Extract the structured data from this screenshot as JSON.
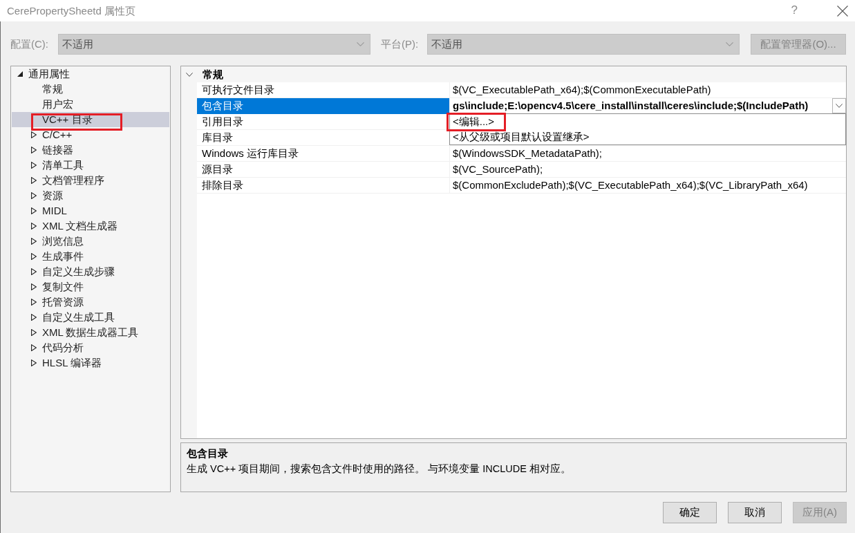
{
  "window": {
    "title": "CerePropertySheetd 属性页",
    "help": "?"
  },
  "config_bar": {
    "configuration": {
      "label": "配置(C):",
      "value": "不适用",
      "disabled": true
    },
    "platform": {
      "label": "平台(P):",
      "value": "不适用",
      "disabled": true
    },
    "manager_button": {
      "label": "配置管理器(O)...",
      "disabled": true
    }
  },
  "tree": {
    "items": [
      {
        "label": "通用属性",
        "kind": "folder",
        "expanded": true,
        "selected": false,
        "highlighted": false,
        "children": [
          {
            "label": "常规",
            "kind": "page",
            "selected": false,
            "highlighted": false
          },
          {
            "label": "用户宏",
            "kind": "page",
            "selected": false,
            "highlighted": false
          },
          {
            "label": "VC++ 目录",
            "kind": "page",
            "selected": true,
            "highlighted": true
          },
          {
            "label": "C/C++",
            "kind": "folder",
            "expanded": false,
            "selected": false,
            "highlighted": false
          },
          {
            "label": "链接器",
            "kind": "folder",
            "expanded": false,
            "selected": false,
            "highlighted": false
          },
          {
            "label": "清单工具",
            "kind": "folder",
            "expanded": false,
            "selected": false,
            "highlighted": false
          },
          {
            "label": "文档管理程序",
            "kind": "folder",
            "expanded": false,
            "selected": false,
            "highlighted": false
          },
          {
            "label": "资源",
            "kind": "folder",
            "expanded": false,
            "selected": false,
            "highlighted": false
          },
          {
            "label": "MIDL",
            "kind": "folder",
            "expanded": false,
            "selected": false,
            "highlighted": false
          },
          {
            "label": "XML 文档生成器",
            "kind": "folder",
            "expanded": false,
            "selected": false,
            "highlighted": false
          },
          {
            "label": "浏览信息",
            "kind": "folder",
            "expanded": false,
            "selected": false,
            "highlighted": false
          },
          {
            "label": "生成事件",
            "kind": "folder",
            "expanded": false,
            "selected": false,
            "highlighted": false
          },
          {
            "label": "自定义生成步骤",
            "kind": "folder",
            "expanded": false,
            "selected": false,
            "highlighted": false
          },
          {
            "label": "复制文件",
            "kind": "folder",
            "expanded": false,
            "selected": false,
            "highlighted": false
          },
          {
            "label": "托管资源",
            "kind": "folder",
            "expanded": false,
            "selected": false,
            "highlighted": false
          },
          {
            "label": "自定义生成工具",
            "kind": "folder",
            "expanded": false,
            "selected": false,
            "highlighted": false
          },
          {
            "label": "XML 数据生成器工具",
            "kind": "folder",
            "expanded": false,
            "selected": false,
            "highlighted": false
          },
          {
            "label": "代码分析",
            "kind": "folder",
            "expanded": false,
            "selected": false,
            "highlighted": false
          },
          {
            "label": "HLSL 编译器",
            "kind": "folder",
            "expanded": false,
            "selected": false,
            "highlighted": false
          }
        ]
      }
    ]
  },
  "grid": {
    "categories": [
      {
        "label": "常规",
        "expanded": true,
        "rows": [
          {
            "name": "可执行文件目录",
            "value": "$(VC_ExecutablePath_x64);$(CommonExecutablePath)",
            "selected": false,
            "modified": false
          },
          {
            "name": "包含目录",
            "value": "gs\\include;E:\\opencv4.5\\cere_install\\install\\ceres\\include;$(IncludePath)",
            "selected": true,
            "modified": true,
            "options": [
              {
                "label": "<编辑...>",
                "highlighted": true
              },
              {
                "label": "<从父级或项目默认设置继承>",
                "highlighted": false
              }
            ]
          },
          {
            "name": "引用目录",
            "selected": false
          },
          {
            "name": "库目录",
            "selected": false
          },
          {
            "name": "Windows 运行库目录",
            "value": "$(WindowsSDK_MetadataPath);",
            "selected": false,
            "modified": false
          },
          {
            "name": "源目录",
            "value": "$(VC_SourcePath);",
            "selected": false,
            "modified": false
          },
          {
            "name": "排除目录",
            "value": "$(CommonExcludePath);$(VC_ExecutablePath_x64);$(VC_LibraryPath_x64)",
            "selected": false,
            "modified": false
          }
        ]
      }
    ]
  },
  "description": {
    "title": "包含目录",
    "text": "生成 VC++ 项目期间，搜索包含文件时使用的路径。 与环境变量 INCLUDE 相对应。"
  },
  "buttons": [
    {
      "label": "确定",
      "disabled": false
    },
    {
      "label": "取消",
      "disabled": false
    },
    {
      "label": "应用(A)",
      "disabled": true
    }
  ]
}
